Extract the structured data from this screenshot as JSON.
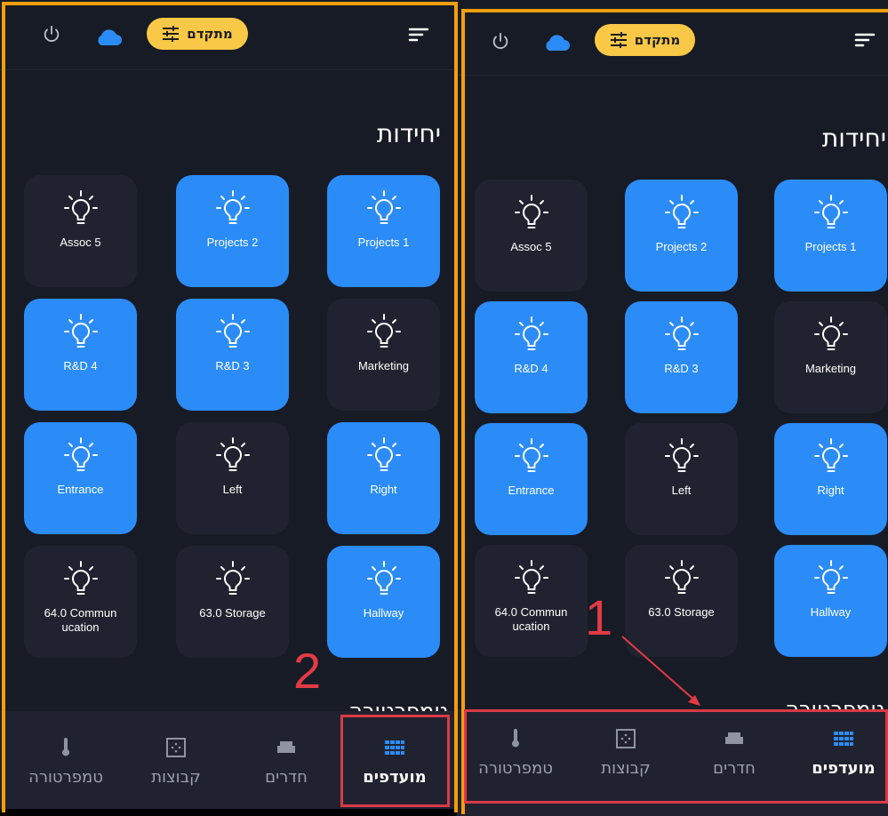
{
  "topbar": {
    "pill_label": "מתקדם",
    "icons": [
      "power-icon",
      "cloud-icon",
      "sliders-icon",
      "sort-icon"
    ]
  },
  "section": {
    "title": "יחידות",
    "next_section_title": "טמפרטורה"
  },
  "tiles": [
    {
      "label": "Projects 1",
      "on": true
    },
    {
      "label": "Projects 2",
      "on": true
    },
    {
      "label": "Assoc 5",
      "on": false
    },
    {
      "label": "Marketing",
      "on": false
    },
    {
      "label": "R&D 3",
      "on": true
    },
    {
      "label": "R&D 4",
      "on": true
    },
    {
      "label": "Right",
      "on": true
    },
    {
      "label": "Left",
      "on": false
    },
    {
      "label": "Entrance",
      "on": true
    },
    {
      "label": "Hallway",
      "on": true
    },
    {
      "label": "63.0 Storage",
      "on": false
    },
    {
      "label": "64.0 Commun ucation",
      "on": false
    }
  ],
  "nav": {
    "favorites": "מועדפים",
    "rooms": "חדרים",
    "groups": "קבוצות",
    "temperature": "טמפרטורה"
  },
  "annotations": {
    "left_number": "2",
    "right_number": "1"
  },
  "colors": {
    "background": "#171b25",
    "tile_off": "#20232f",
    "tile_on": "#2b8cf7",
    "accent_pill": "#f9c846",
    "frame": "#f59e0b",
    "annotation_red": "#e23b45"
  }
}
